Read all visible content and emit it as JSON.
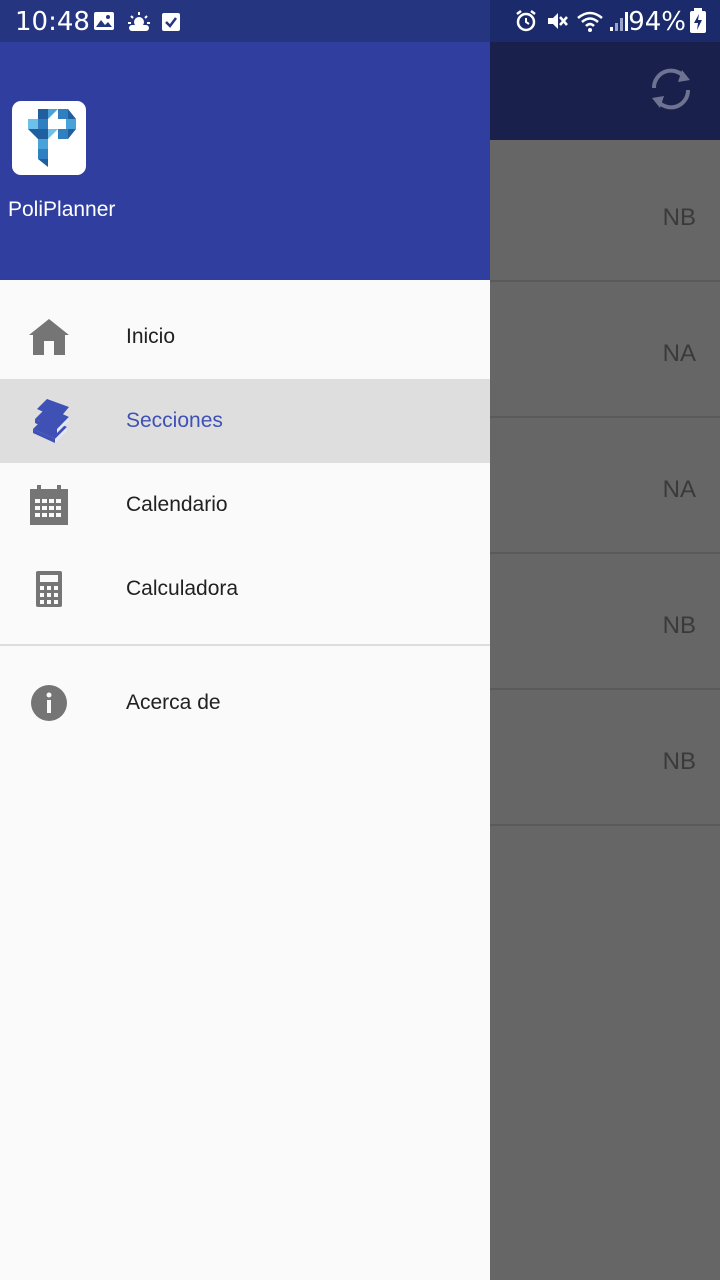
{
  "status_bar": {
    "time": "10:48",
    "battery": "94%",
    "left_icons": [
      "image-icon",
      "weather-icon",
      "checkbox-icon"
    ],
    "right_icons": [
      "alarm-icon",
      "mute-icon",
      "wifi-icon",
      "signal-icon",
      "battery-charging-icon"
    ]
  },
  "drawer": {
    "app_name": "PoliPlanner",
    "items": [
      {
        "label": "Inicio",
        "icon": "home-icon",
        "selected": false
      },
      {
        "label": "Secciones",
        "icon": "books-icon",
        "selected": true
      },
      {
        "label": "Calendario",
        "icon": "calendar-icon",
        "selected": false
      },
      {
        "label": "Calculadora",
        "icon": "calculator-icon",
        "selected": false
      }
    ],
    "secondary_items": [
      {
        "label": "Acerca de",
        "icon": "info-icon"
      }
    ]
  },
  "background_screen": {
    "toolbar_icon": "sync-icon",
    "rows": [
      {
        "grade": "NB"
      },
      {
        "grade": "NA"
      },
      {
        "grade": "NA"
      },
      {
        "grade": "NB"
      },
      {
        "grade": "NB"
      }
    ]
  },
  "colors": {
    "primary": "#303f9f",
    "accent_text": "#3f51b5",
    "selected_bg": "#dedede",
    "scrim": "#666666"
  }
}
